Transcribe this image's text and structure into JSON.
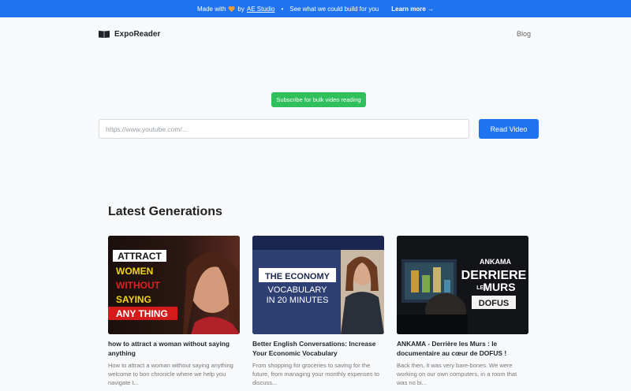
{
  "banner": {
    "made_with": "Made with",
    "by": "by",
    "studio": "AE Studio",
    "pitch": "See what we could build for you",
    "learn_more": "Learn more →",
    "heart_icon": "heart-icon",
    "heart_color": "#f0a030"
  },
  "nav": {
    "brand": "ExpoReader",
    "brand_icon": "open-book-icon",
    "blog": "Blog"
  },
  "subscribe_label": "Subscribe for bulk video reading",
  "search": {
    "placeholder": "https://www.youtube.com/...",
    "button": "Read Video"
  },
  "latest": {
    "title": "Latest Generations",
    "cards": [
      {
        "thumb_lines": [
          "ATTRACT",
          "WOMEN",
          "WITHOUT",
          "SAYING",
          "ANY THING"
        ],
        "title": "how to attract a woman without saying anything",
        "desc": "How to attract a woman without saying anything welcome to bon chronicle where we help you navigate t..."
      },
      {
        "thumb_lines": [
          "THE ECONOMY",
          "VOCABULARY",
          "IN 20 MINUTES"
        ],
        "title": "Better English Conversations: Increase Your Economic Vocabulary",
        "desc": "From shopping for groceries to saving for the future, from managing your monthly expenses to discuss..."
      },
      {
        "thumb_lines": [
          "ANKAMA",
          "DERRIERE",
          "LES",
          "MURS",
          "DOFUS"
        ],
        "title": "ANKAMA - Derrière les Murs : le documentaire au cœur de DOFUS !",
        "desc": "Back then, it was very bare-bones. We were working on our own computers, in a room that was no bi..."
      }
    ]
  },
  "colors": {
    "accent": "#1f73f0",
    "subscribe": "#2fbf5b"
  }
}
